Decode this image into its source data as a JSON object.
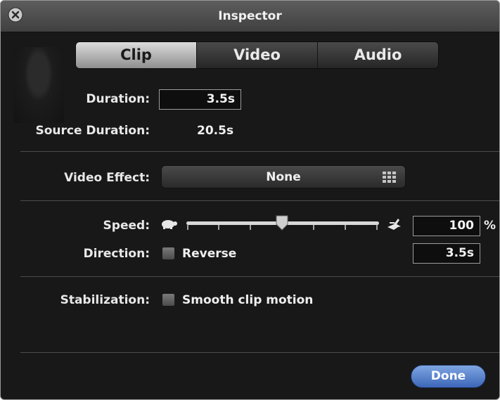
{
  "window": {
    "title": "Inspector"
  },
  "tabs": [
    {
      "label": "Clip",
      "active": true
    },
    {
      "label": "Video",
      "active": false
    },
    {
      "label": "Audio",
      "active": false
    }
  ],
  "clip": {
    "duration_label": "Duration:",
    "duration_value": "3.5s",
    "source_duration_label": "Source Duration:",
    "source_duration_value": "20.5s"
  },
  "video_effect": {
    "label": "Video Effect:",
    "value": "None",
    "icon": "grid-icon"
  },
  "speed": {
    "label": "Speed:",
    "value": "100",
    "unit": "%",
    "slider_level": 0.5,
    "slow_icon": "turtle-icon",
    "fast_icon": "rabbit-icon"
  },
  "direction": {
    "label": "Direction:",
    "checkbox_label": "Reverse",
    "checked": false,
    "duration": "3.5s"
  },
  "stabilization": {
    "label": "Stabilization:",
    "checkbox_label": "Smooth clip motion",
    "checked": false
  },
  "footer": {
    "done_label": "Done"
  },
  "colors": {
    "done_button": "#4a74c6",
    "panel_bg": "#181818"
  }
}
